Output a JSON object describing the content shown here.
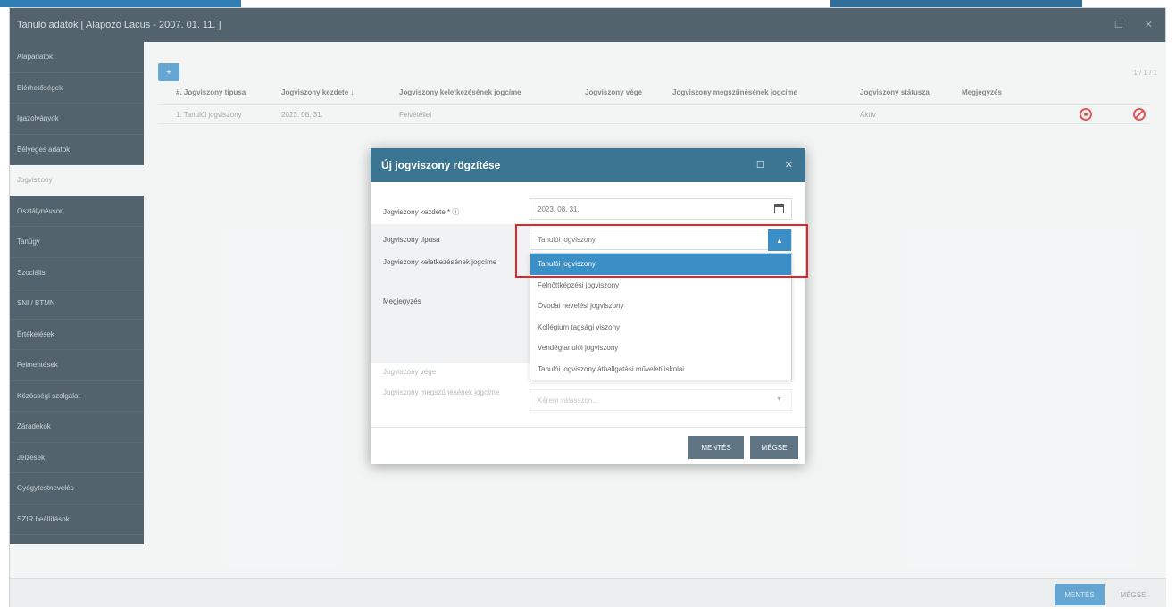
{
  "window": {
    "title": "Tanuló adatok [ Alapozó Lacus - 2007. 01. 11. ]"
  },
  "sidebar": {
    "items": [
      {
        "label": "Alapadatok"
      },
      {
        "label": "Elérhetőségek"
      },
      {
        "label": "Igazolványok"
      },
      {
        "label": "Bélyeges adatok"
      },
      {
        "label": "Jogviszony"
      },
      {
        "label": "Osztálynévsor"
      },
      {
        "label": "Tanügy"
      },
      {
        "label": "Szociális"
      },
      {
        "label": "SNI / BTMN"
      },
      {
        "label": "Értékelések"
      },
      {
        "label": "Felmentések"
      },
      {
        "label": "Közösségi szolgálat"
      },
      {
        "label": "Záradékok"
      },
      {
        "label": "Jelzések"
      },
      {
        "label": "Gyógytestnevelés"
      },
      {
        "label": "SZIR beállítások"
      }
    ]
  },
  "table": {
    "pager": "1 / 1 / 1",
    "headers": [
      "#. Jogviszony típusa",
      "Jogviszony kezdete ↓",
      "Jogviszony keletkezésének jogcíme",
      "Jogviszony vége",
      "Jogviszony megszűnésének jogcíme",
      "Jogviszony státusza",
      "Megjegyzés"
    ],
    "row": [
      "1. Tanulói jogviszony",
      "2023. 08. 31.",
      "Felvétellel",
      "",
      "",
      "Aktív",
      ""
    ]
  },
  "modal": {
    "title": "Új jogviszony rögzítése",
    "labels": {
      "start": "Jogviszony kezdete * ⓘ",
      "type": "Jogviszony típusa",
      "origin": "Jogviszony keletkezésének jogcíme",
      "note": "Megjegyzés",
      "end": "Jogviszony vége",
      "end_reason": "Jogviszony megszűnésének jogcíme"
    },
    "start_value": "2023. 08. 31.",
    "type_value": "Tanulói jogviszony",
    "end_reason_placeholder": "Kérem válasszon...",
    "options": [
      {
        "label": "Tanulói jogviszony",
        "selected": true
      },
      {
        "label": "Felnőttképzési jogviszony"
      },
      {
        "label": "Óvodai nevelési jogviszony"
      },
      {
        "label": "Kollégium tagsági viszony"
      },
      {
        "label": "Vendégtanulói jogviszony"
      },
      {
        "label": "Tanulói jogviszony áthallgatási műveleti iskolai"
      }
    ],
    "save_label": "MENTÉS",
    "cancel_label": "MÉGSE"
  },
  "footer": {
    "save_label": "MENTÉS",
    "cancel_label": "MÉGSE"
  },
  "colors": {
    "primary": "#3a8fc6",
    "dark": "#233845",
    "modal_header": "#3b7591",
    "highlight": "#e3242b"
  }
}
